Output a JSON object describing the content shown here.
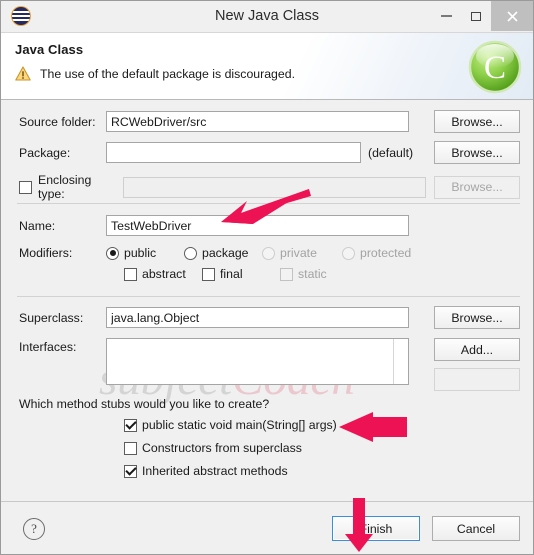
{
  "window": {
    "title": "New Java Class",
    "app_icon": "eclipse-icon",
    "controls": {
      "minimize": "–",
      "maximize": "□",
      "close": "✕"
    }
  },
  "header": {
    "heading": "Java Class",
    "message": "The use of the default package is discouraged.",
    "warning_icon": "warning-triangle-icon",
    "logo": "green-c-logo"
  },
  "fields": {
    "source_folder": {
      "label": "Source folder:",
      "value": "RCWebDriver/src",
      "button": "Browse..."
    },
    "package": {
      "label": "Package:",
      "value": "",
      "suffix": "(default)",
      "button": "Browse..."
    },
    "enclosing_type": {
      "label": "Enclosing type:",
      "checked": false,
      "value": "",
      "button": "Browse...",
      "disabled": true
    },
    "name": {
      "label": "Name:",
      "value": "TestWebDriver"
    },
    "modifiers": {
      "label": "Modifiers:",
      "radios": [
        {
          "label": "public",
          "selected": true,
          "disabled": false
        },
        {
          "label": "package",
          "selected": false,
          "disabled": false
        },
        {
          "label": "private",
          "selected": false,
          "disabled": true
        },
        {
          "label": "protected",
          "selected": false,
          "disabled": true
        }
      ],
      "checkboxes": [
        {
          "label": "abstract",
          "checked": false,
          "disabled": false
        },
        {
          "label": "final",
          "checked": false,
          "disabled": false
        },
        {
          "label": "static",
          "checked": false,
          "disabled": true
        }
      ]
    },
    "superclass": {
      "label": "Superclass:",
      "value": "java.lang.Object",
      "button": "Browse..."
    },
    "interfaces": {
      "label": "Interfaces:",
      "value": "",
      "add_button": "Add..."
    }
  },
  "stubs": {
    "question": "Which method stubs would you like to create?",
    "items": [
      {
        "label": "public static void main(String[] args)",
        "checked": true
      },
      {
        "label": "Constructors from superclass",
        "checked": false
      },
      {
        "label": "Inherited abstract methods",
        "checked": true
      }
    ]
  },
  "footer": {
    "help_icon": "?",
    "finish": "Finish",
    "cancel": "Cancel"
  },
  "watermark": {
    "part1": "subject",
    "part2": "Coach"
  },
  "annotations": {
    "color": "#ed1254",
    "arrows": [
      "arrow-to-name-field",
      "arrow-to-main-stub-checkbox",
      "arrow-to-finish-button"
    ]
  }
}
